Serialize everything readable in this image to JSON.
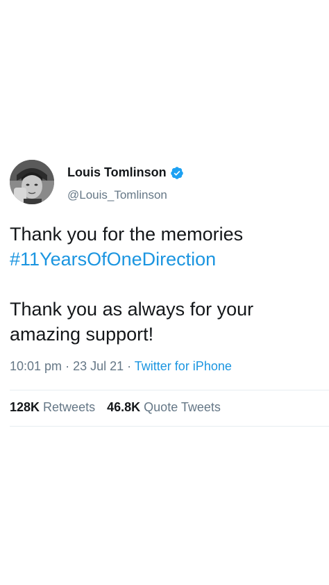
{
  "tweet": {
    "author": {
      "display_name": "Louis Tomlinson",
      "handle": "@Louis_Tomlinson",
      "verified": true,
      "avatar_icon": "profile-photo"
    },
    "text": {
      "line1": "Thank you for the memories",
      "hashtag": "#11YearsOfOneDirection",
      "line3": "Thank you as always for your",
      "line4": "amazing support!"
    },
    "meta": {
      "time": "10:01 pm",
      "separator1": " · ",
      "date": "23 Jul 21",
      "separator2": " · ",
      "source": "Twitter for iPhone"
    },
    "stats": {
      "retweets_count": "128K",
      "retweets_label": "Retweets",
      "quote_count": "46.8K",
      "quote_label": "Quote Tweets"
    }
  },
  "colors": {
    "link": "#1b95e0",
    "text": "#14171a",
    "secondary": "#657786",
    "verified": "#1da1f2",
    "divider": "#e6ecf0"
  }
}
